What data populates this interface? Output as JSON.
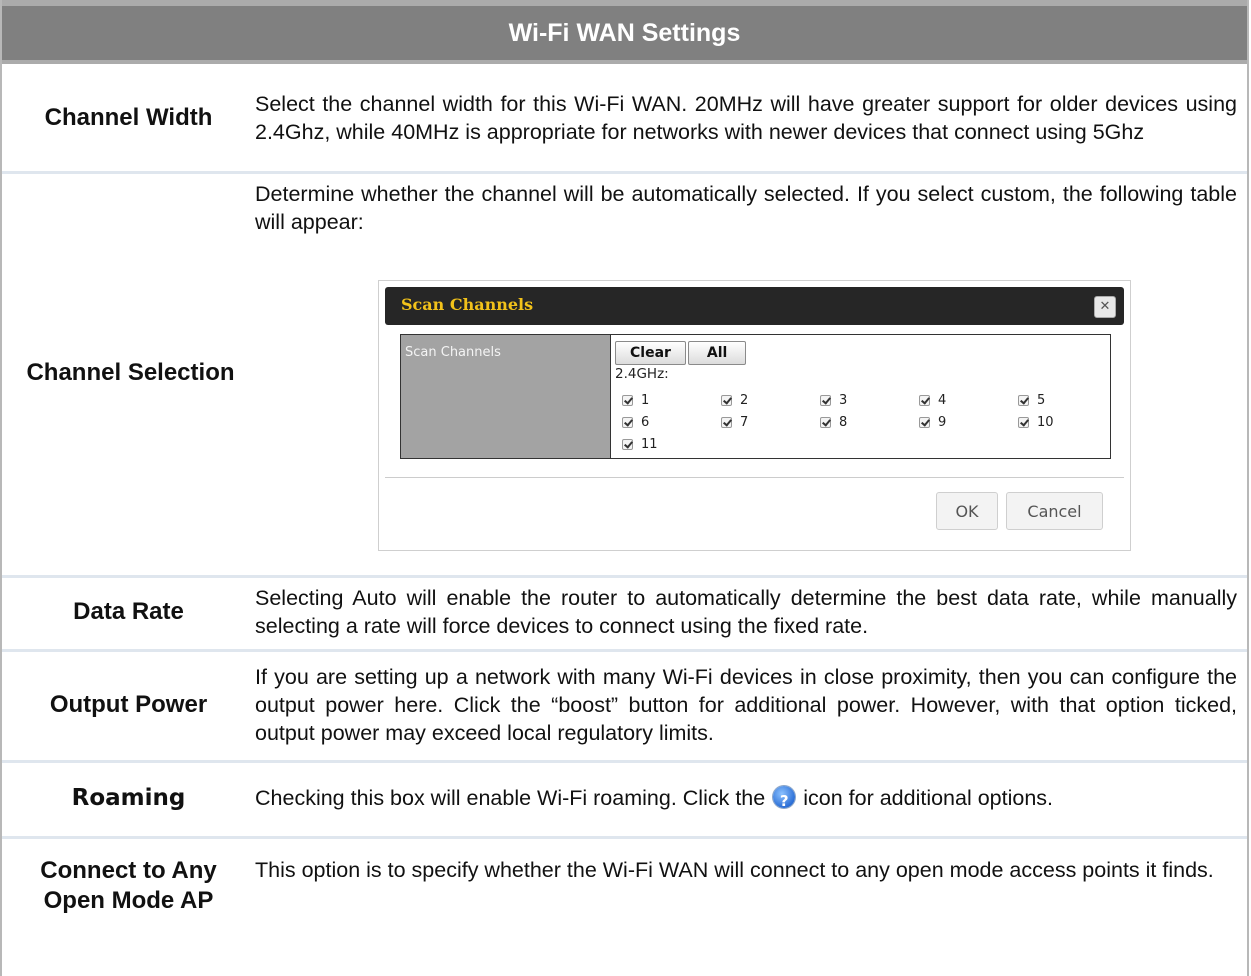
{
  "header": {
    "title": "Wi-Fi WAN Settings"
  },
  "rows": [
    {
      "label": "Channel Width",
      "description": "Select the channel width for this Wi-Fi WAN. 20MHz will have greater support for older devices using 2.4Ghz, while 40MHz is appropriate for networks with newer devices that connect using 5Ghz"
    },
    {
      "label": "Channel Selection",
      "description": "Determine whether the channel will be automatically selected. If you select custom, the following table will appear:"
    },
    {
      "label": "Data Rate",
      "description": "Selecting Auto will enable the router to automatically determine the best data rate, while manually selecting a rate will force devices to connect using the fixed rate."
    },
    {
      "label": "Output Power",
      "description": "If you are setting up a network with many Wi-Fi devices in close proximity, then you can configure the output power here. Click the “boost” button for additional power. However, with that option ticked, output power may exceed local regulatory limits."
    },
    {
      "label": "Roaming",
      "description_before": "Checking this box will enable Wi-Fi roaming. Click the",
      "description_after": "icon for additional options."
    },
    {
      "label": "Connect to Any Open Mode AP",
      "description": "This option is to specify whether the Wi-Fi WAN will connect to any open mode access points it finds."
    }
  ],
  "dialog": {
    "title": "Scan Channels",
    "close_icon": "close-icon",
    "field_label": "Scan Channels",
    "clear_label": "Clear",
    "all_label": "All",
    "band_label": "2.4GHz:",
    "channels": [
      {
        "number": "1",
        "checked": true
      },
      {
        "number": "2",
        "checked": true
      },
      {
        "number": "3",
        "checked": true
      },
      {
        "number": "4",
        "checked": true
      },
      {
        "number": "5",
        "checked": true
      },
      {
        "number": "6",
        "checked": true
      },
      {
        "number": "7",
        "checked": true
      },
      {
        "number": "8",
        "checked": true
      },
      {
        "number": "9",
        "checked": true
      },
      {
        "number": "10",
        "checked": true
      },
      {
        "number": "11",
        "checked": true
      }
    ],
    "ok_label": "OK",
    "cancel_label": "Cancel"
  },
  "colors": {
    "header_bg": "#808080",
    "dialog_title_text": "#f2c21a",
    "dialog_title_bg": "#262626",
    "row_separator": "#dfe6ee"
  }
}
